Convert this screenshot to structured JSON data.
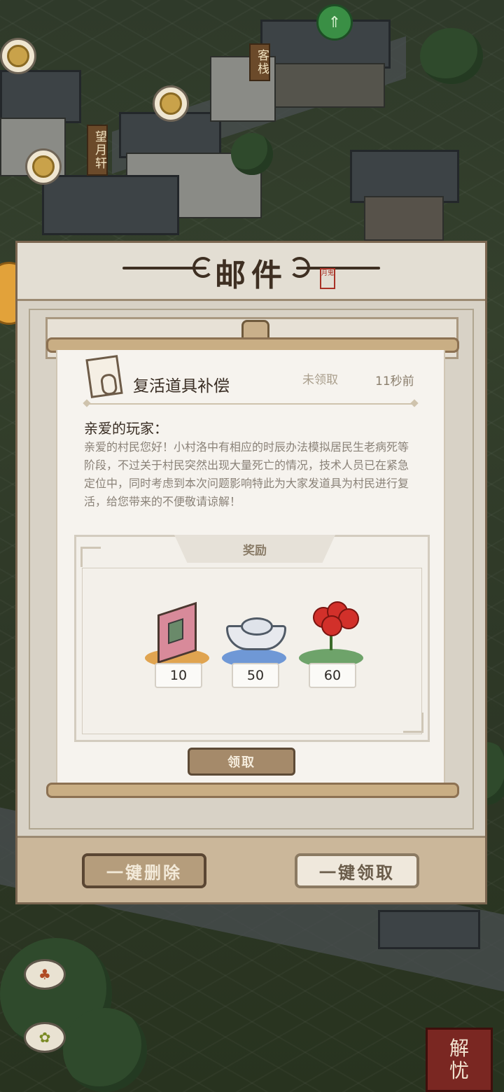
{
  "map": {
    "signs": [
      "客栈",
      "望月轩"
    ]
  },
  "mail_panel": {
    "title": "邮件",
    "seal_text": "月鬼",
    "footer": {
      "delete_all_label": "一键删除",
      "claim_all_label": "一键领取"
    }
  },
  "mail": {
    "title": "复活道具补偿",
    "status": "未领取",
    "time": "11秒前",
    "greeting": "亲爱的玩家：",
    "body": "亲爱的村民您好！小村洛中有相应的时辰办法模拟居民生老病死等阶段，不过关于村民突然出现大量死亡的情况，技术人员已在紧急定位中，同时考虑到本次问题影响特此为大家发道具为村民进行复活，给您带来的不便敬请谅解！",
    "reward_header": "奖励",
    "rewards": [
      {
        "icon": "book-icon",
        "count": "10",
        "disk_color": "#e0a450"
      },
      {
        "icon": "silver-ingot-icon",
        "count": "50",
        "disk_color": "#6f98d6"
      },
      {
        "icon": "red-spider-lily-icon",
        "count": "60",
        "disk_color": "#6ea36a"
      }
    ],
    "claim_label": "领取"
  },
  "corner_button": {
    "label_top": "解",
    "label_bottom": "忧"
  }
}
